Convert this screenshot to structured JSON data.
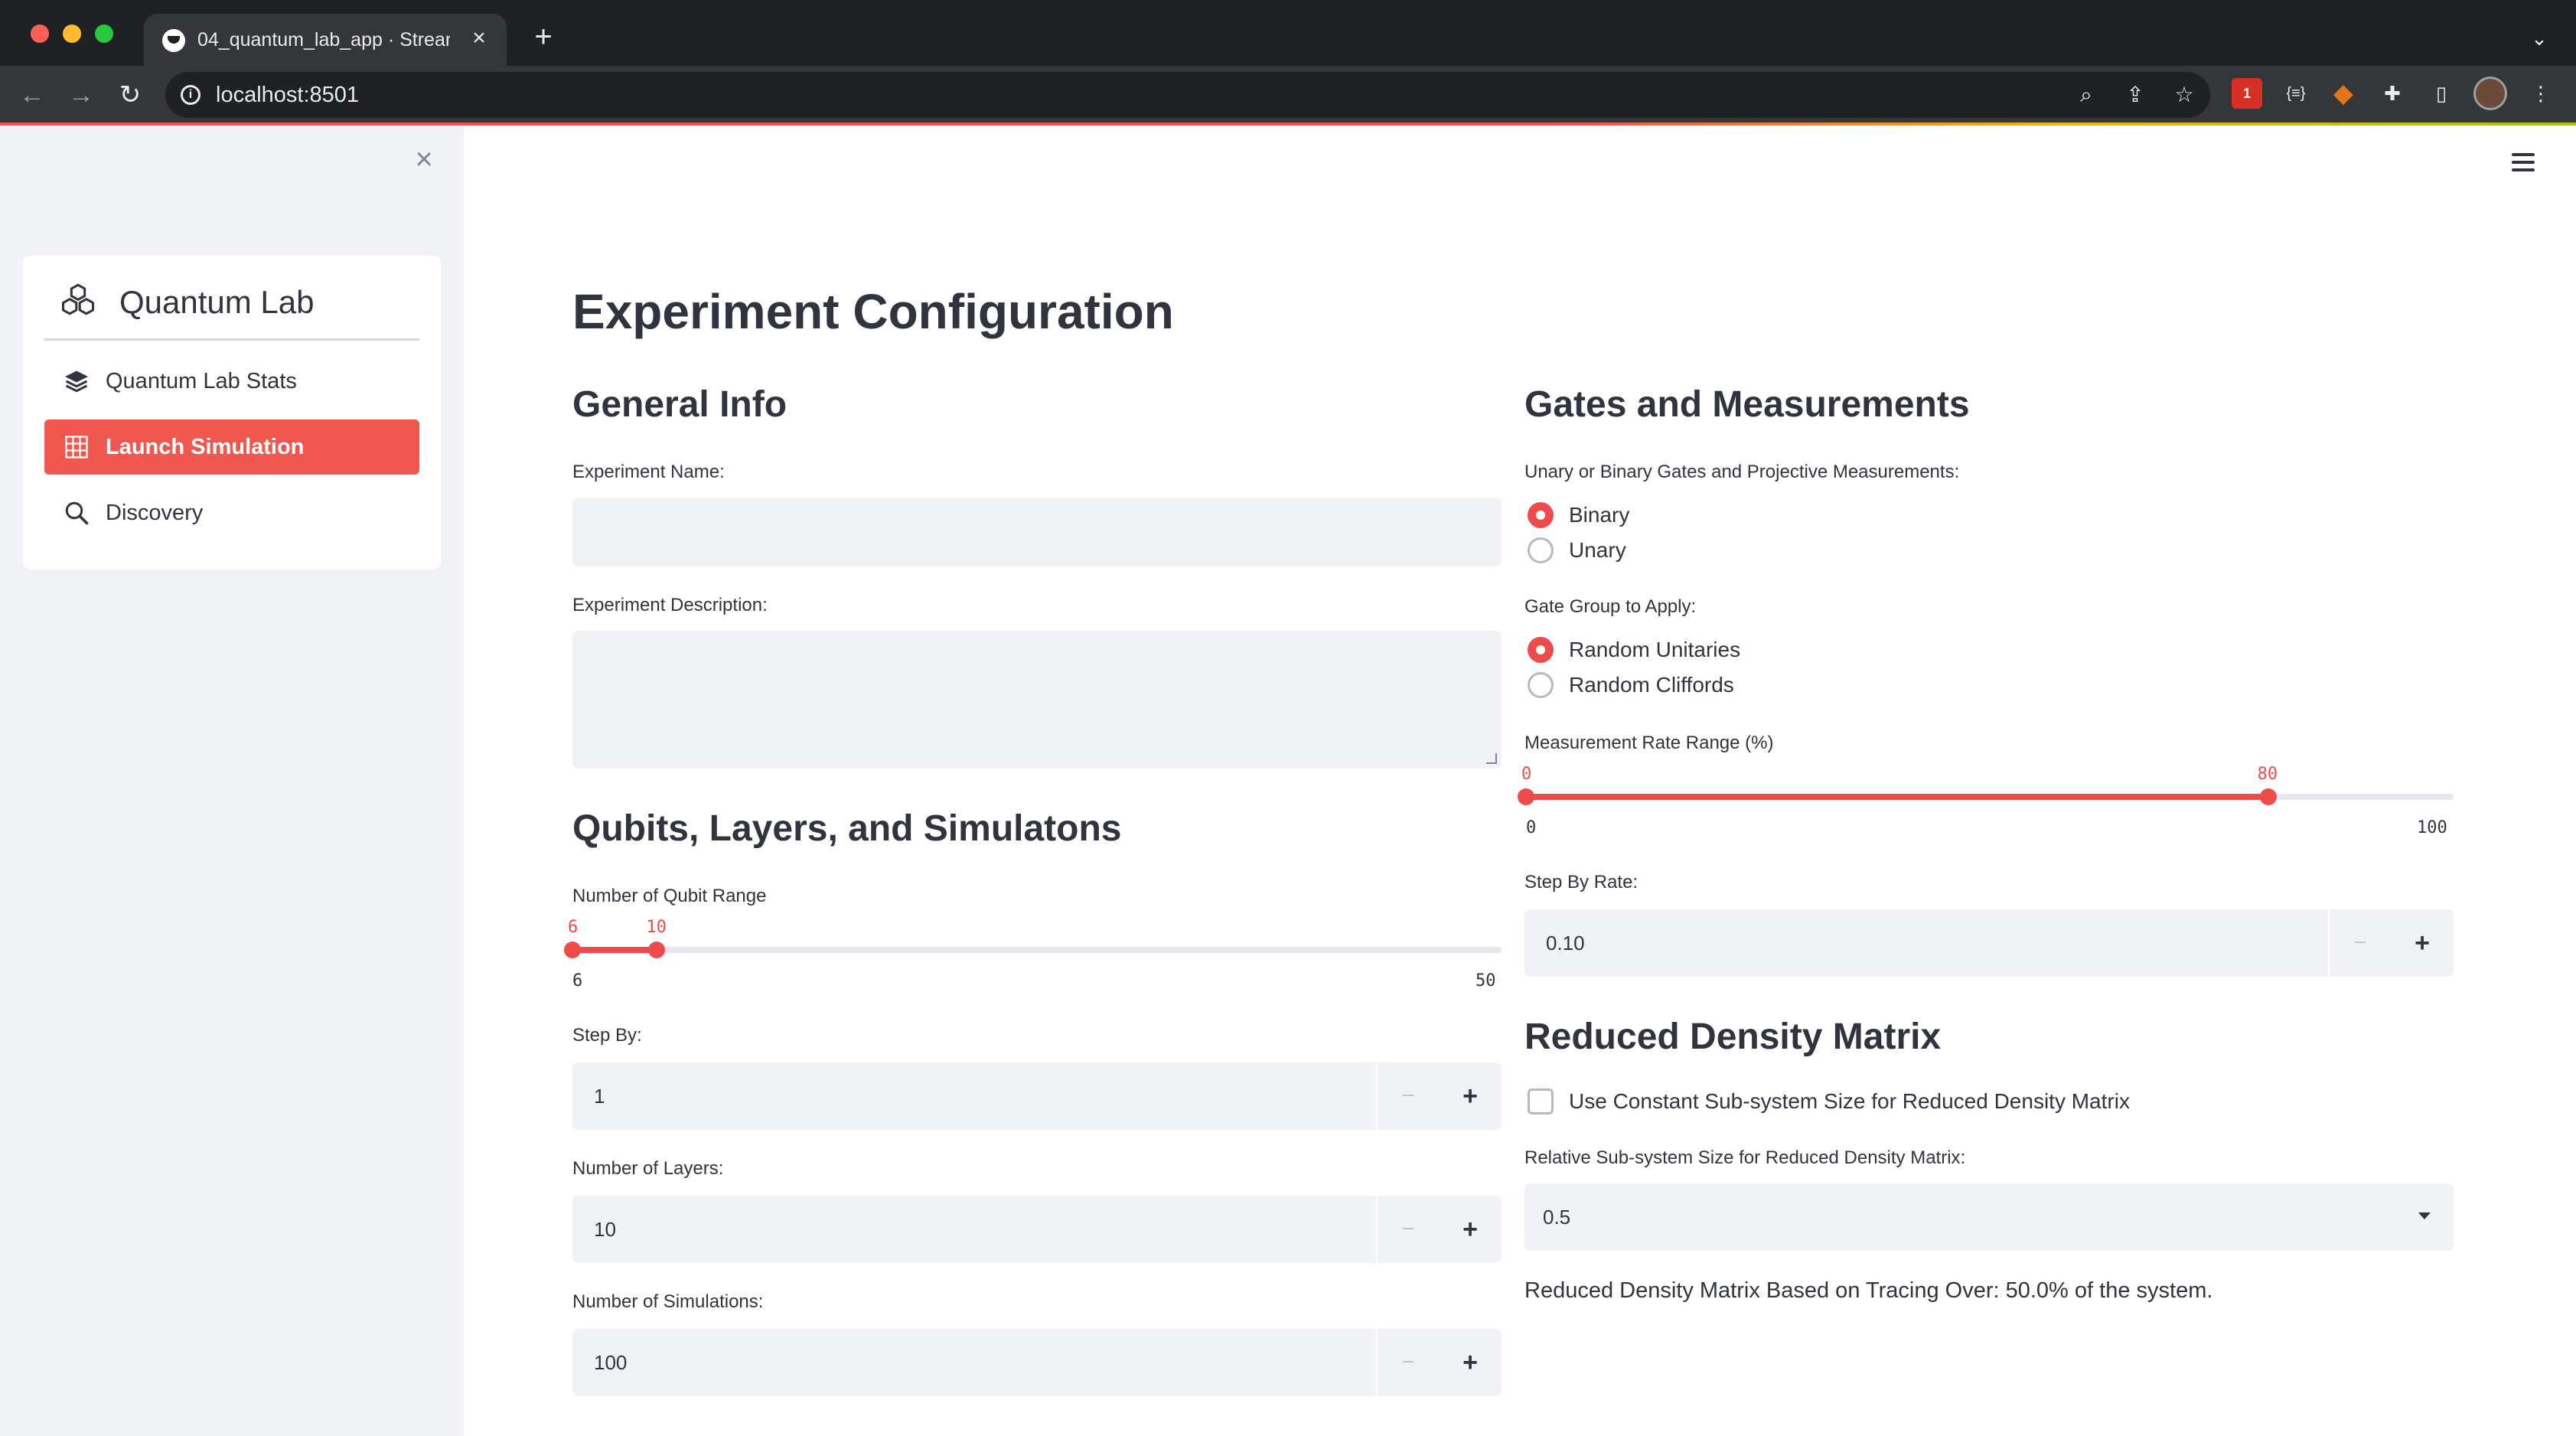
{
  "browser": {
    "tab_title": "04_quantum_lab_app · Streamlit",
    "tab_close": "×",
    "new_tab": "+",
    "tab_menu": "⌄",
    "url": "localhost:8501",
    "ext_badge": "1",
    "ext_json": "{≡}"
  },
  "sidebar": {
    "close": "×",
    "brand": "Quantum Lab",
    "items": [
      {
        "label": "Quantum Lab Stats",
        "icon": "layers-icon",
        "active": false
      },
      {
        "label": "Launch Simulation",
        "icon": "grid-icon",
        "active": true
      },
      {
        "label": "Discovery",
        "icon": "search-icon",
        "active": false
      }
    ],
    "accent": "#f0584f"
  },
  "main": {
    "title": "Experiment Configuration",
    "general": {
      "heading": "General Info",
      "name_label": "Experiment Name:",
      "name_value": "",
      "desc_label": "Experiment Description:",
      "desc_value": ""
    },
    "qubits": {
      "heading": "Qubits, Layers, and Simulatons",
      "range_label": "Number of Qubit Range",
      "range_low": 6,
      "range_high": 10,
      "range_min": 6,
      "range_max": 50,
      "step_label": "Step By:",
      "step_value": "1",
      "layers_label": "Number of Layers:",
      "layers_value": "10",
      "sims_label": "Number of Simulations:",
      "sims_value": "100",
      "minus": "−",
      "plus": "+"
    },
    "gates": {
      "heading": "Gates and Measurements",
      "type_label": "Unary or Binary Gates and Projective Measurements:",
      "type_options": [
        "Binary",
        "Unary"
      ],
      "type_selected": "Binary",
      "group_label": "Gate Group to Apply:",
      "group_options": [
        "Random Unitaries",
        "Random Cliffords"
      ],
      "group_selected": "Random Unitaries",
      "rate_label": "Measurement Rate Range (%)",
      "rate_low": 0,
      "rate_high": 80,
      "rate_min": 0,
      "rate_max": 100,
      "step_rate_label": "Step By Rate:",
      "step_rate_value": "0.10"
    },
    "rdm": {
      "heading": "Reduced Density Matrix",
      "checkbox_label": "Use Constant Sub-system Size for Reduced Density Matrix",
      "checkbox_checked": false,
      "size_label": "Relative Sub-system Size for Reduced Density Matrix:",
      "size_value": "0.5",
      "summary": "Reduced Density Matrix Based on Tracing Over: 50.0% of the system."
    },
    "accent": "#ee4b4b"
  }
}
